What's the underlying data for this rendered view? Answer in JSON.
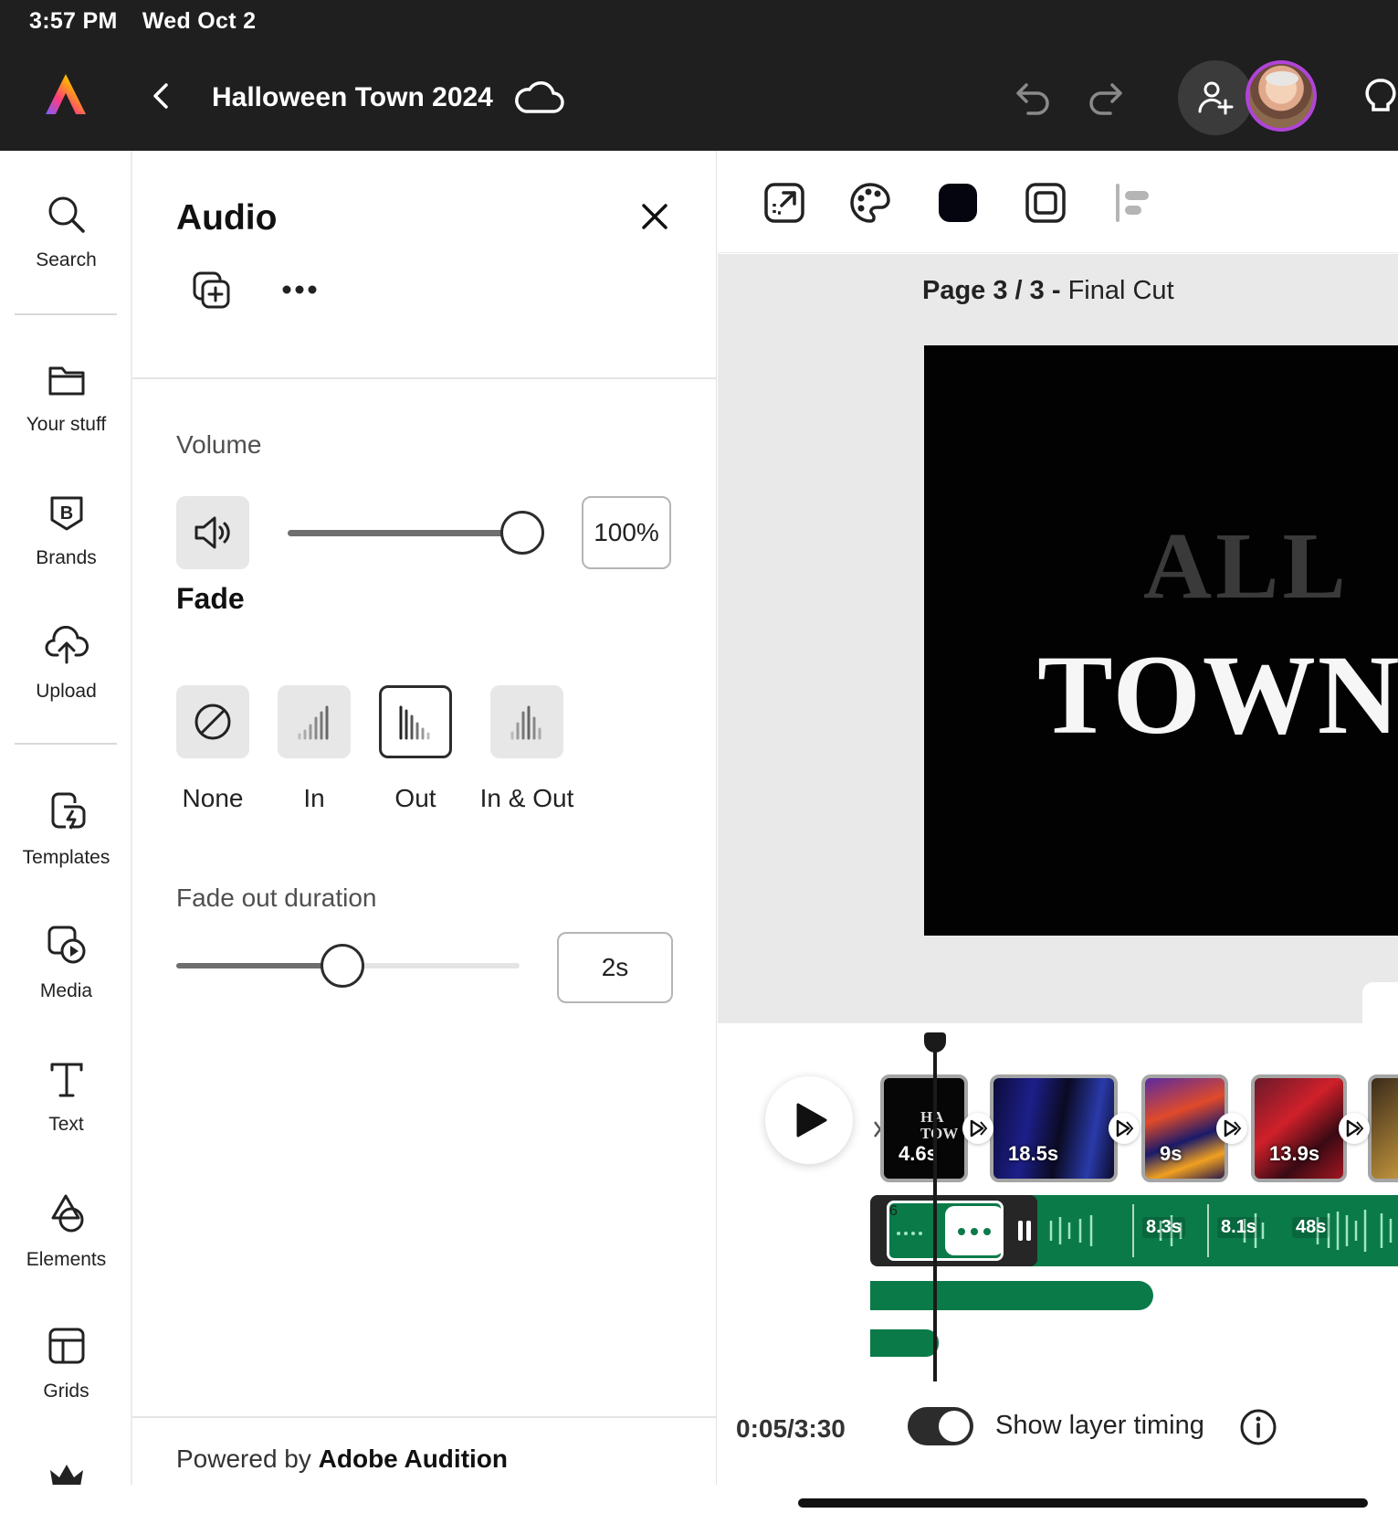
{
  "status_bar": {
    "time": "3:57 PM",
    "date": "Wed Oct 2"
  },
  "header": {
    "title": "Halloween Town 2024"
  },
  "rail": {
    "items": [
      {
        "label": "Search",
        "icon": "search-icon"
      },
      {
        "label": "Your stuff",
        "icon": "folder-icon"
      },
      {
        "label": "Brands",
        "icon": "brand-icon"
      },
      {
        "label": "Upload",
        "icon": "upload-cloud-icon"
      },
      {
        "label": "Templates",
        "icon": "templates-icon"
      },
      {
        "label": "Media",
        "icon": "media-icon"
      },
      {
        "label": "Text",
        "icon": "text-icon"
      },
      {
        "label": "Elements",
        "icon": "elements-icon"
      },
      {
        "label": "Grids",
        "icon": "grids-icon"
      }
    ]
  },
  "panel": {
    "title": "Audio",
    "volume_label": "Volume",
    "volume_value": "100%",
    "volume_level": 1.0,
    "fade_heading": "Fade",
    "fade_options": [
      "None",
      "In",
      "Out",
      "In & Out"
    ],
    "fade_selected": "Out",
    "fade_duration_label": "Fade out duration",
    "fade_duration_value": "2s",
    "powered_prefix": "Powered by ",
    "powered_brand": "Adobe Audition"
  },
  "stage": {
    "page_prefix": "Page 3 / 3 - ",
    "page_name": "Final Cut",
    "canvas_line1": "ALL",
    "canvas_line2": "TOWN"
  },
  "timeline": {
    "clips": [
      "4.6s",
      "18.5s",
      "9s",
      "13.9s"
    ],
    "audio_segments": [
      "6",
      "8.3s",
      "8.1s",
      "48s"
    ],
    "time": "0:05/3:30",
    "toggle_label": "Show layer timing",
    "toggle_on": true
  },
  "colors": {
    "accent_green": "#0a7a48",
    "topbar": "#1f1f1f",
    "avatar_ring": "#b044d9"
  }
}
